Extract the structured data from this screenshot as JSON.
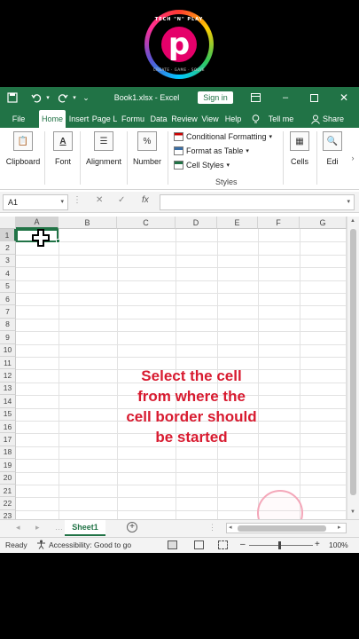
{
  "logo": {
    "top_text": "TECH \"N\" PLAY",
    "letter": "p",
    "bottom_text": "CREATE · GAME · SOLVE"
  },
  "titlebar": {
    "filename": "Book1.xlsx - Excel",
    "signin": "Sign in"
  },
  "tabs": [
    "File",
    "Home",
    "Insert",
    "Page L",
    "Formu",
    "Data",
    "Review",
    "View",
    "Help",
    "Tell me",
    "Share"
  ],
  "ribbon": {
    "clipboard": "Clipboard",
    "font": "Font",
    "alignment": "Alignment",
    "number": "Number",
    "number_icon": "%",
    "conditional": "Conditional Formatting",
    "format_table": "Format as Table",
    "cell_styles": "Cell Styles",
    "styles": "Styles",
    "cells": "Cells",
    "editing": "Edi"
  },
  "formula_bar": {
    "name_box": "A1",
    "fx": "fx"
  },
  "columns": [
    "A",
    "B",
    "C",
    "D",
    "E",
    "F",
    "G"
  ],
  "rows": [
    "1",
    "2",
    "3",
    "4",
    "5",
    "6",
    "7",
    "8",
    "9",
    "10",
    "11",
    "12",
    "13",
    "14",
    "15",
    "16",
    "17",
    "18",
    "19",
    "20",
    "21",
    "22",
    "23"
  ],
  "instruction": [
    "Select the cell",
    "from where the",
    "cell border should",
    "be started"
  ],
  "sheet": {
    "tab": "Sheet1"
  },
  "status": {
    "ready": "Ready",
    "accessibility": "Accessibility: Good to go",
    "zoom": "100%"
  }
}
